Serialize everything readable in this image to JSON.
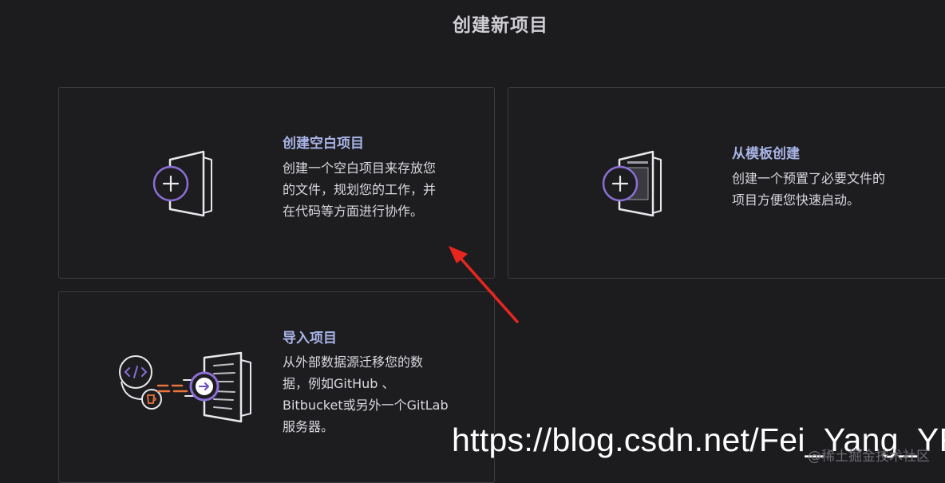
{
  "page": {
    "title": "创建新项目"
  },
  "cards": {
    "blank": {
      "title": "创建空白项目",
      "desc": [
        "创建一个空白项目来存放您",
        "的文件，规划您的工作，并",
        "在代码等方面进行协作。"
      ],
      "icon": "blank-project-plus-icon"
    },
    "template": {
      "title": "从模板创建",
      "desc": [
        "创建一个预置了必要文件的",
        "项目方便您快速启动。"
      ],
      "icon": "template-project-icon"
    },
    "import": {
      "title": "导入项目",
      "desc": [
        "从外部数据源迁移您的数",
        "据，例如GitHub 、",
        "Bitbucket或另外一个GitLab",
        "服务器。"
      ],
      "icon": "import-project-icon"
    }
  },
  "watermark": {
    "url": "https://blog.csdn.net/Fei_Yang_YF",
    "small": "@稀土掘金技术社区"
  },
  "colors": {
    "background": "#1c1c1f",
    "card_border": "#3b3b40",
    "card_title": "#a9b4e6",
    "accent_purple": "#8b6fd6",
    "annotation_red": "#e8261e",
    "orange": "#e8743b"
  }
}
